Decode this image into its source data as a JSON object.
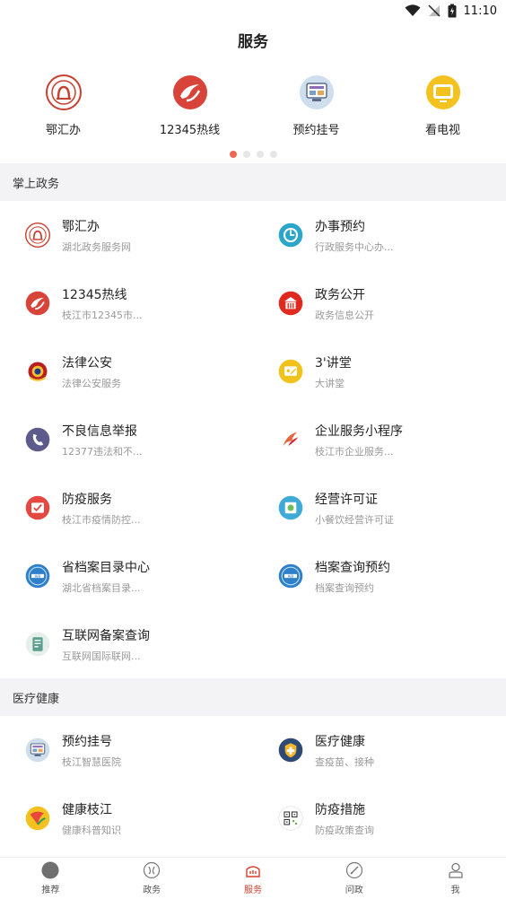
{
  "status_bar": {
    "time": "11:10"
  },
  "header": {
    "title": "服务"
  },
  "carousel": {
    "items": [
      {
        "label": "鄂汇办",
        "icon": "ehuiban-icon",
        "color": "#c8402f"
      },
      {
        "label": "12345热线",
        "icon": "hotline-icon",
        "color": "#d8433a"
      },
      {
        "label": "预约挂号",
        "icon": "register-icon",
        "color": "#8fb3d1"
      },
      {
        "label": "看电视",
        "icon": "tv-icon",
        "color": "#f3c21e"
      }
    ],
    "active_page": 1,
    "page_count": 4
  },
  "sections": [
    {
      "title": "掌上政务",
      "items": [
        {
          "name": "鄂汇办",
          "desc": "湖北政务服务网",
          "icon": "ehuiban-icon",
          "color": "#c8402f"
        },
        {
          "name": "办事预约",
          "desc": "行政服务中心办...",
          "icon": "appointment-icon",
          "color": "#2ba6c9"
        },
        {
          "name": "12345热线",
          "desc": "枝江市12345市...",
          "icon": "hotline-icon",
          "color": "#d8433a"
        },
        {
          "name": "政务公开",
          "desc": "政务信息公开",
          "icon": "gov-open-icon",
          "color": "#e02a20"
        },
        {
          "name": "法律公安",
          "desc": "法律公安服务",
          "icon": "police-badge-icon",
          "color": "#b91f1f"
        },
        {
          "name": "3'讲堂",
          "desc": "大讲堂",
          "icon": "lecture-icon",
          "color": "#f2c21c"
        },
        {
          "name": "不良信息举报",
          "desc": "12377违法和不...",
          "icon": "phone-report-icon",
          "color": "#5d5a8c"
        },
        {
          "name": "企业服务小程序",
          "desc": "枝江市企业服务...",
          "icon": "enterprise-icon",
          "color": "#e8643a"
        },
        {
          "name": "防疫服务",
          "desc": "枝江市疫情防控...",
          "icon": "epidemic-icon",
          "color": "#e54840"
        },
        {
          "name": "经营许可证",
          "desc": "小餐饮经营许可证",
          "icon": "license-icon",
          "color": "#3fa9d8"
        },
        {
          "name": "省档案目录中心",
          "desc": "湖北省档案目录...",
          "icon": "archive-icon",
          "color": "#2f7fc9"
        },
        {
          "name": "档案查询预约",
          "desc": "档案查询预约",
          "icon": "archive-query-icon",
          "color": "#2f7fc9"
        },
        {
          "name": "互联网备案查询",
          "desc": "互联网国际联网...",
          "icon": "filing-icon",
          "color": "#5c9f8e"
        }
      ]
    },
    {
      "title": "医疗健康",
      "items": [
        {
          "name": "预约挂号",
          "desc": "枝江智慧医院",
          "icon": "register-icon",
          "color": "#8fb3d1"
        },
        {
          "name": "医疗健康",
          "desc": "查疫苗、接种",
          "icon": "medical-icon",
          "color": "#2c4a73"
        },
        {
          "name": "健康枝江",
          "desc": "健康科普知识",
          "icon": "health-icon",
          "color": "#f3c21e"
        },
        {
          "name": "防疫措施",
          "desc": "防疫政策查询",
          "icon": "qr-code-icon",
          "color": "#6aa84f"
        }
      ]
    }
  ],
  "tabbar": {
    "items": [
      {
        "label": "推荐",
        "icon": "recommend-icon"
      },
      {
        "label": "政务",
        "icon": "government-icon"
      },
      {
        "label": "服务",
        "icon": "service-icon"
      },
      {
        "label": "问政",
        "icon": "inquiry-icon"
      },
      {
        "label": "我",
        "icon": "profile-icon"
      }
    ],
    "active": "服务",
    "active_color": "#d7402c"
  }
}
